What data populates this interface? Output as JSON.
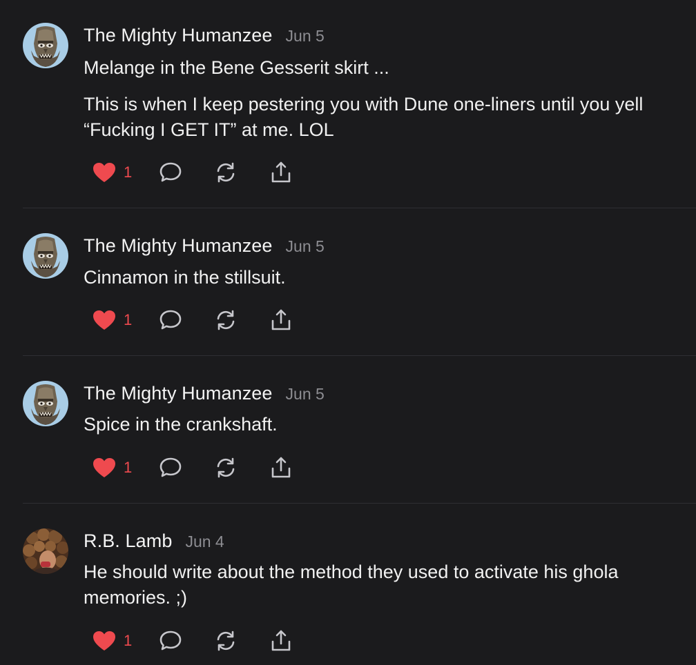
{
  "comments": [
    {
      "author": "The Mighty Humanzee",
      "date": "Jun 5",
      "paragraphs": [
        "Melange in the Bene Gesserit skirt ...",
        "This is when I keep pestering you with Dune one-liners until you yell “Fucking I GET IT” at me. LOL"
      ],
      "likes": "1",
      "avatar_icon": "mask-avatar-icon"
    },
    {
      "author": "The Mighty Humanzee",
      "date": "Jun 5",
      "paragraphs": [
        "Cinnamon in the stillsuit."
      ],
      "likes": "1",
      "avatar_icon": "mask-avatar-icon"
    },
    {
      "author": "The Mighty Humanzee",
      "date": "Jun 5",
      "paragraphs": [
        "Spice in the crankshaft."
      ],
      "likes": "1",
      "avatar_icon": "mask-avatar-icon"
    },
    {
      "author": "R.B. Lamb",
      "date": "Jun 4",
      "paragraphs": [
        "He should write about the method they used to activate his ghola memories. ;)"
      ],
      "likes": "1",
      "avatar_icon": "curly-hair-avatar-icon"
    }
  ],
  "actions": {
    "like_icon": "heart-icon",
    "reply_icon": "speech-bubble-icon",
    "restack_icon": "refresh-arrows-icon",
    "share_icon": "share-upload-icon"
  },
  "colors": {
    "background": "#1b1b1d",
    "text": "#f2f2f2",
    "muted": "#8d8d92",
    "like": "#ef4a4f",
    "divider": "#2f2f33"
  }
}
